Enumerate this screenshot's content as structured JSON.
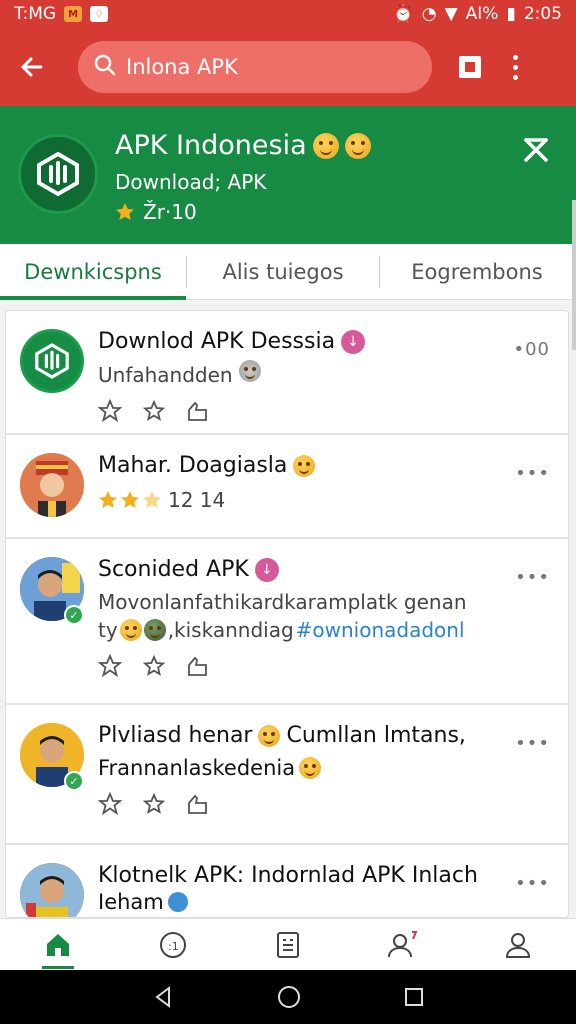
{
  "status_bar": {
    "carrier": "T:MG",
    "right_text": "AI%",
    "time": "2:05"
  },
  "app_bar": {
    "search_value": "Inlona APK"
  },
  "header": {
    "title": "APK Indonesia",
    "subtitle": "Download; APK",
    "rating": "Žr·10"
  },
  "tabs": [
    {
      "label": "Dewnkicspns"
    },
    {
      "label": "Alis tuiegos"
    },
    {
      "label": "Eogrembons"
    }
  ],
  "posts": [
    {
      "title": "Downlod APK Desssia",
      "text": "Unfahandden",
      "more": "•00"
    },
    {
      "title": "Mahar. Doagiasla",
      "rating": "12 14",
      "more": "•••"
    },
    {
      "title": "Sconided APK",
      "text": "Movonlanfathikardkaramplatk genan",
      "text2": "ty",
      "text3": ",kiskanndiag",
      "hashtag": "#ownionadadonl",
      "more": "•••"
    },
    {
      "title": "Plvliasd henar",
      "title2": "Cumllan lmtans,",
      "text": "Frannanlaskedenia",
      "more": "•••"
    },
    {
      "title": "Klotnelk APK: Indornlad APK Inlach",
      "text": "Ieham",
      "more": "•••"
    }
  ],
  "colors": {
    "red_bar": "#d53a33",
    "green_header": "#178a43"
  }
}
